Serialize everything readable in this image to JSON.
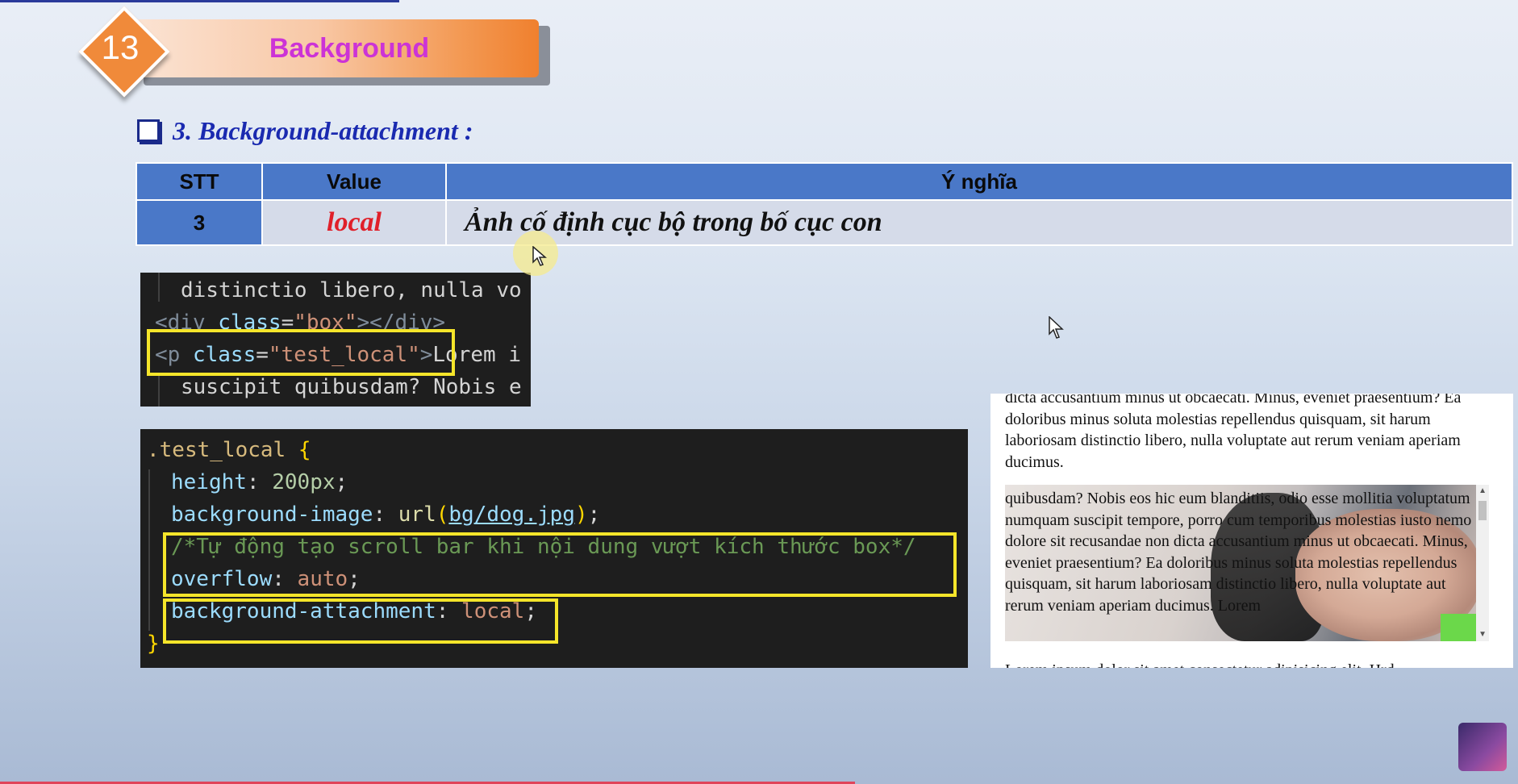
{
  "banner": {
    "number": "13",
    "title": "Background"
  },
  "section": {
    "title": "3. Background-attachment :"
  },
  "table": {
    "headers": [
      "STT",
      "Value",
      "Ý nghĩa"
    ],
    "rows": [
      {
        "stt": "3",
        "value": "local",
        "meaning": "Ảnh cố định cục bộ trong bố cục con"
      }
    ]
  },
  "html_code": {
    "line1": "distinctio libero, nulla vo",
    "line2_tag_open": "<div ",
    "line2_attr": "class",
    "line2_eq": "=",
    "line2_val": "\"box\"",
    "line2_tag_close": "></div>",
    "line3_tag_open": "<p ",
    "line3_attr": "class",
    "line3_eq": "=",
    "line3_val": "\"test_local\"",
    "line3_tag_close": ">",
    "line3_text": "Lorem i",
    "line4": "suscipit quibusdam? Nobis e"
  },
  "css_code": {
    "selector": ".test_local",
    "open_brace": " {",
    "height_prop": "height",
    "height_val": "200px",
    "bgimg_prop": "background-image",
    "bgimg_fn": "url",
    "bgimg_arg": "bg/dog.jpg",
    "comment": "/*Tự động tạo scroll bar khi nội dung vượt kích thước box*/",
    "overflow_prop": "overflow",
    "overflow_val": "auto",
    "attach_prop": "background-attachment",
    "attach_val": "local",
    "close_brace": "}"
  },
  "preview": {
    "para1": "dicta accusantium minus ut obcaecati. Minus, eveniet praesentium? Ea doloribus minus soluta molestias repellendus quisquam, sit harum laboriosam distinctio libero, nulla voluptate aut rerum veniam aperiam ducimus.",
    "scroll_text": "quibusdam? Nobis eos hic eum blanditiis, odio esse mollitia voluptatum numquam suscipit tempore, porro cum temporibus molestias iusto nemo dolore sit recusandae non dicta accusantium minus ut obcaecati. Minus, eveniet praesentium? Ea doloribus minus soluta molestias repellendus quisquam, sit harum laboriosam distinctio libero, nulla voluptate aut rerum veniam aperiam ducimus. Lorem",
    "para3": "Lorem ipsum dolor sit amet consectetur adipisicing elit. Hrd"
  },
  "colors": {
    "header_blue": "#4a78c8",
    "value_red": "#e0202a",
    "highlight_yellow": "#f5e52a",
    "banner_orange": "#f0802e",
    "title_magenta": "#cc33d6"
  }
}
